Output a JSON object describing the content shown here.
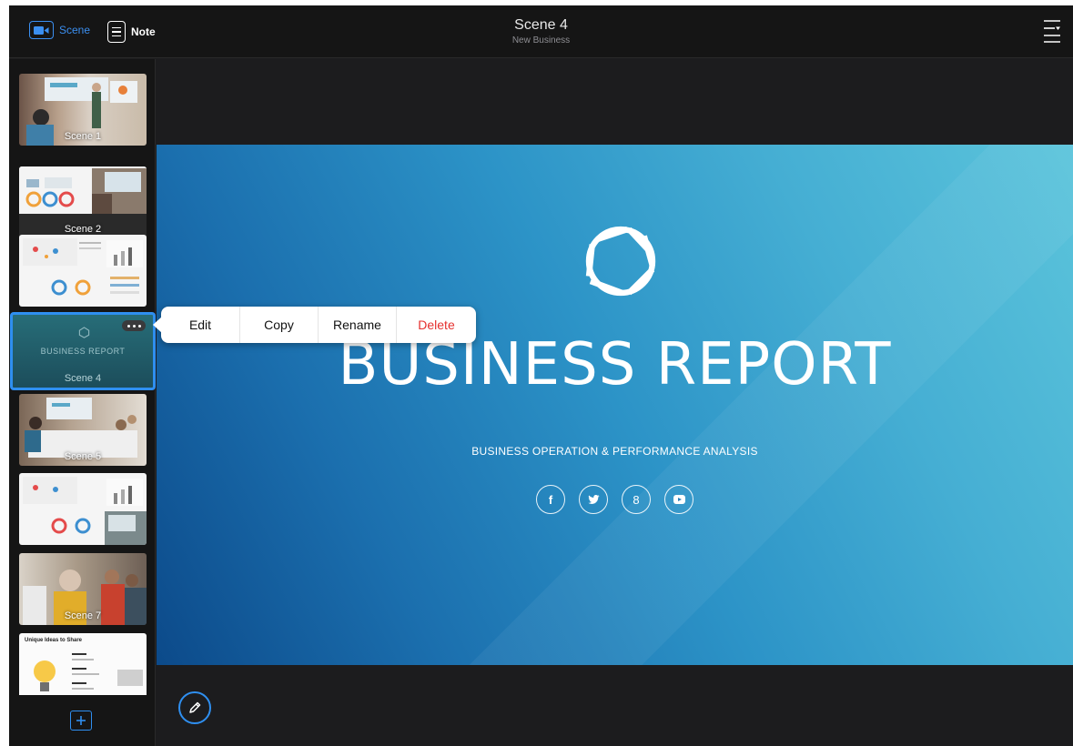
{
  "topbar": {
    "scene_tab": "Scene",
    "note_tab": "Note",
    "title": "Scene 4",
    "subtitle": "New Business"
  },
  "sidebar": {
    "scenes": [
      {
        "label": "Scene 1"
      },
      {
        "label": "Scene 2"
      },
      {
        "label": ""
      },
      {
        "label": "Scene 4",
        "preview_title": "BUSINESS REPORT",
        "selected": true
      },
      {
        "label": "Scene 5"
      },
      {
        "label": ""
      },
      {
        "label": "Scene 7"
      },
      {
        "label": "",
        "preview_title": "Unique Ideas to Share"
      }
    ]
  },
  "context_menu": {
    "edit": "Edit",
    "copy": "Copy",
    "rename": "Rename",
    "delete": "Delete"
  },
  "slide": {
    "title": "BUSINESS REPORT",
    "subtitle": "BUSINESS OPERATION & PERFORMANCE ANALYSIS",
    "socials": [
      {
        "icon": "facebook-icon",
        "glyph": "f"
      },
      {
        "icon": "twitter-icon",
        "glyph": "t"
      },
      {
        "icon": "google-icon",
        "glyph": "8"
      },
      {
        "icon": "youtube-icon",
        "glyph": "▶"
      }
    ]
  },
  "colors": {
    "accent": "#2f8ff0",
    "delete": "#e5312f",
    "background": "#1c1c1e"
  }
}
